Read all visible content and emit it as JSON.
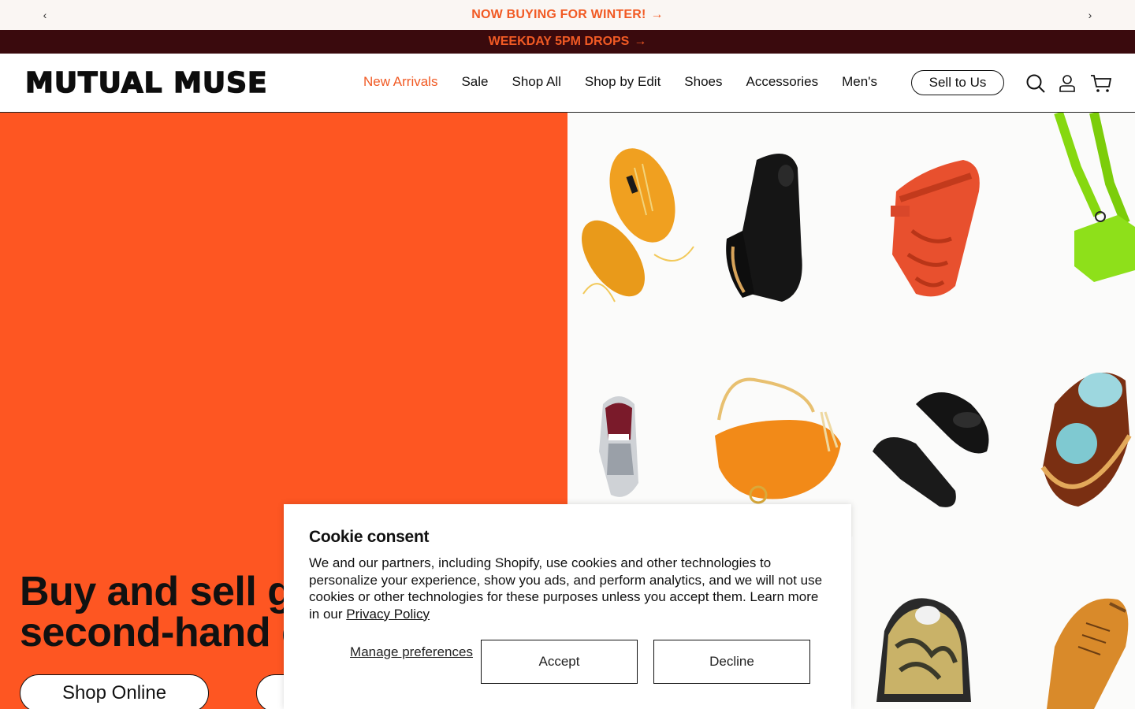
{
  "announcement": {
    "message": "NOW BUYING FOR WINTER!",
    "arrow": "→",
    "prev_icon": "‹",
    "next_icon": "›"
  },
  "drops_bar": {
    "message": "WEEKDAY 5PM DROPS",
    "arrow": "→"
  },
  "header": {
    "logo": "MUTUAL MUSE",
    "nav": [
      {
        "label": "New Arrivals",
        "active": true
      },
      {
        "label": "Sale"
      },
      {
        "label": "Shop All"
      },
      {
        "label": "Shop by Edit"
      },
      {
        "label": "Shoes"
      },
      {
        "label": "Accessories"
      },
      {
        "label": "Men's"
      }
    ],
    "sell_button": "Sell to Us",
    "icons": [
      "search-icon",
      "account-icon",
      "cart-icon"
    ]
  },
  "hero": {
    "title_line1": "Buy and sell g",
    "title_line2": "second-hand c",
    "buttons": [
      "Shop Online",
      ""
    ],
    "accent_color": "#fe5622"
  },
  "product_grid": {
    "tiles": [
      {
        "name": "orange-suede-sneakers"
      },
      {
        "name": "black-leather-ankle-boot"
      },
      {
        "name": "red-platform-mary-jane"
      },
      {
        "name": "lime-green-shoulder-bag"
      },
      {
        "name": "silver-adidas-sneaker"
      },
      {
        "name": "orange-hobo-bag"
      },
      {
        "name": "black-leather-mules"
      },
      {
        "name": "brown-platform-clog"
      },
      {
        "name": "snake-print-platform-loafer"
      },
      {
        "name": "tan-lace-up-oxford"
      }
    ]
  },
  "cookie": {
    "title": "Cookie consent",
    "body": "We and our partners, including Shopify, use cookies and other technologies to personalize your experience, show you ads, and perform analytics, and we will not use cookies or other technologies for these purposes unless you accept them. Learn more in our ",
    "link": "Privacy Policy",
    "manage": "Manage preferences",
    "accept": "Accept",
    "decline": "Decline"
  }
}
